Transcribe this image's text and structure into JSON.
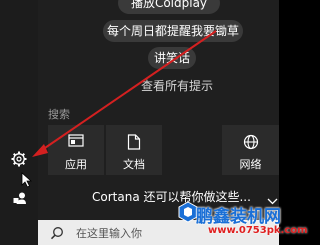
{
  "suggestions": {
    "play": "播放Coldplay",
    "remind": "每个周日都提醒我要锄草",
    "joke": "讲笑话",
    "show_all": "查看所有提示"
  },
  "search_section_label": "搜索",
  "tiles": [
    {
      "label": "应用",
      "icon": "apps-icon"
    },
    {
      "label": "文档",
      "icon": "document-icon"
    },
    {
      "label": "网络",
      "icon": "globe-icon"
    }
  ],
  "cortana_prompt": "Cortana 还可以帮你做这些...",
  "search_box": {
    "placeholder": "在这里输入你"
  },
  "watermark": {
    "title": "鹏鑫装机网",
    "url": "www.0753pk.com"
  },
  "colors": {
    "arrow": "#d42020",
    "background": "#1f1f1f",
    "tile": "#2b2b2b"
  }
}
